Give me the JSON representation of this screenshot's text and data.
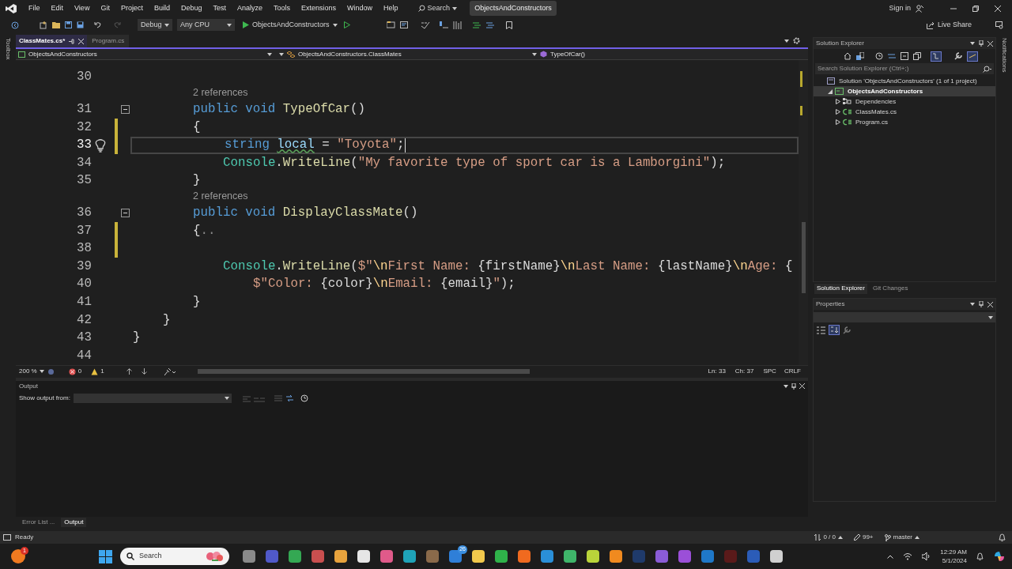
{
  "title_bar": {
    "menu": [
      "File",
      "Edit",
      "View",
      "Git",
      "Project",
      "Build",
      "Debug",
      "Test",
      "Analyze",
      "Tools",
      "Extensions",
      "Window",
      "Help"
    ],
    "search": "Search",
    "solution": "ObjectsAndConstructors",
    "sign_in": "Sign in"
  },
  "toolbar": {
    "configuration": "Debug",
    "platform": "Any CPU",
    "run_target": "ObjectsAndConstructors",
    "live_share": "Live Share"
  },
  "side_strips": {
    "left": "Toolbox",
    "right": "Notifications"
  },
  "editor": {
    "tabs": [
      {
        "label": "ClassMates.cs*",
        "selected": true
      },
      {
        "label": "Program.cs",
        "selected": false
      }
    ],
    "navigation": [
      "ObjectsAndConstructors",
      "ObjectsAndConstructors.ClassMates",
      "TypeOfCar()"
    ],
    "lines": [
      {
        "number": "30",
        "current": false,
        "changed": false,
        "lightbulb": false,
        "collapsible": false
      },
      {
        "number": "31",
        "current": false,
        "changed": false,
        "lightbulb": false,
        "collapsible": true,
        "codelens": "2 references",
        "tokens": [
          {
            "kind": "keyword",
            "text": "        public void "
          },
          {
            "kind": "method",
            "text": "TypeOfCar"
          },
          {
            "kind": "plain",
            "text": "()"
          }
        ]
      },
      {
        "number": "32",
        "current": false,
        "changed": true,
        "lightbulb": false,
        "collapsible": false,
        "tokens": [
          {
            "kind": "plain",
            "text": "        {"
          }
        ]
      },
      {
        "number": "33",
        "current": true,
        "changed": true,
        "lightbulb": true,
        "collapsible": false,
        "tokens": [
          {
            "kind": "keyword",
            "text": "            string "
          },
          {
            "kind": "warning",
            "text": "local"
          },
          {
            "kind": "plain",
            "text": " = "
          },
          {
            "kind": "string",
            "text": "\"Toyota\""
          },
          {
            "kind": "plain",
            "text": ";"
          }
        ]
      },
      {
        "number": "34",
        "current": false,
        "changed": false,
        "lightbulb": false,
        "collapsible": false,
        "tokens": [
          {
            "kind": "type",
            "text": "            Console"
          },
          {
            "kind": "plain",
            "text": "."
          },
          {
            "kind": "method",
            "text": "WriteLine"
          },
          {
            "kind": "plain",
            "text": "("
          },
          {
            "kind": "string",
            "text": "\"My favorite type of sport car is a Lamborgini\""
          },
          {
            "kind": "plain",
            "text": ");"
          }
        ]
      },
      {
        "number": "35",
        "current": false,
        "changed": false,
        "lightbulb": false,
        "collapsible": false,
        "tokens": [
          {
            "kind": "plain",
            "text": "        }"
          }
        ]
      },
      {
        "number": "36",
        "current": false,
        "changed": false,
        "lightbulb": false,
        "collapsible": true,
        "codelens": "2 references",
        "tokens": [
          {
            "kind": "keyword",
            "text": "        public void "
          },
          {
            "kind": "method",
            "text": "DisplayClassMate"
          },
          {
            "kind": "plain",
            "text": "()"
          }
        ]
      },
      {
        "number": "37",
        "current": false,
        "changed": true,
        "lightbulb": false,
        "collapsible": false,
        "tokens": [
          {
            "kind": "plain",
            "text": "        {"
          },
          {
            "kind": "collapsed",
            "text": ".."
          }
        ]
      },
      {
        "number": "38",
        "current": false,
        "changed": true,
        "lightbulb": false,
        "collapsible": false
      },
      {
        "number": "39",
        "current": false,
        "changed": false,
        "lightbulb": false,
        "collapsible": false,
        "tokens": [
          {
            "kind": "type",
            "text": "            Console"
          },
          {
            "kind": "plain",
            "text": "."
          },
          {
            "kind": "method",
            "text": "WriteLine"
          },
          {
            "kind": "plain",
            "text": "("
          },
          {
            "kind": "string",
            "text": "$\""
          },
          {
            "kind": "escape",
            "text": "\\n"
          },
          {
            "kind": "string",
            "text": "First Name: "
          },
          {
            "kind": "plain",
            "text": "{firstName}"
          },
          {
            "kind": "escape",
            "text": "\\n"
          },
          {
            "kind": "string",
            "text": "Last Name: "
          },
          {
            "kind": "plain",
            "text": "{lastName}"
          },
          {
            "kind": "escape",
            "text": "\\n"
          },
          {
            "kind": "string",
            "text": "Age: "
          },
          {
            "kind": "plain",
            "text": "{"
          }
        ]
      },
      {
        "number": "40",
        "current": false,
        "changed": false,
        "lightbulb": false,
        "collapsible": false,
        "tokens": [
          {
            "kind": "string",
            "text": "                $\"Color: "
          },
          {
            "kind": "plain",
            "text": "{color}"
          },
          {
            "kind": "escape",
            "text": "\\n"
          },
          {
            "kind": "string",
            "text": "Email: "
          },
          {
            "kind": "plain",
            "text": "{email}"
          },
          {
            "kind": "string",
            "text": "\""
          },
          {
            "kind": "plain",
            "text": ");"
          }
        ]
      },
      {
        "number": "41",
        "current": false,
        "changed": false,
        "lightbulb": false,
        "collapsible": false,
        "tokens": [
          {
            "kind": "plain",
            "text": "        }"
          }
        ]
      },
      {
        "number": "42",
        "current": false,
        "changed": false,
        "lightbulb": false,
        "collapsible": false,
        "tokens": [
          {
            "kind": "plain",
            "text": "    }"
          }
        ]
      },
      {
        "number": "43",
        "current": false,
        "changed": false,
        "lightbulb": false,
        "collapsible": false,
        "tokens": [
          {
            "kind": "plain",
            "text": "}"
          }
        ]
      },
      {
        "number": "44",
        "current": false,
        "changed": false,
        "lightbulb": false,
        "collapsible": false
      }
    ],
    "status": {
      "zoom": "200 %",
      "errors": "0",
      "warnings": "1",
      "line": "Ln: 33",
      "column": "Ch: 37",
      "whitespace": "SPC",
      "line_ending": "CRLF"
    }
  },
  "output": {
    "title": "Output",
    "show_from_label": "Show output from:"
  },
  "bottom_tabs": [
    {
      "label": "Error List ...",
      "selected": false
    },
    {
      "label": "Output",
      "selected": true
    }
  ],
  "solution_explorer": {
    "title": "Solution Explorer",
    "search_placeholder": "Search Solution Explorer (Ctrl+;)",
    "tree": [
      {
        "label": "Solution 'ObjectsAndConstructors' (1 of 1 project)",
        "kind": "solution",
        "selected": false,
        "children": [
          {
            "label": "ObjectsAndConstructors",
            "kind": "project",
            "expanded": true,
            "selected": true,
            "children": [
              {
                "label": "Dependencies",
                "kind": "dependencies",
                "expanded": false,
                "selected": false
              },
              {
                "label": "ClassMates.cs",
                "kind": "csharp",
                "expanded": false,
                "selected": false
              },
              {
                "label": "Program.cs",
                "kind": "csharp",
                "expanded": false,
                "selected": false
              }
            ]
          }
        ]
      }
    ]
  },
  "panel_tabs": [
    {
      "label": "Solution Explorer",
      "selected": true
    },
    {
      "label": "Git Changes",
      "selected": false
    }
  ],
  "properties": {
    "title": "Properties"
  },
  "status_bar": {
    "state": "Ready",
    "changes": "0 / 0",
    "edits": "99+",
    "branch": "master"
  },
  "taskbar": {
    "widget_badge": "1",
    "search": "Search",
    "apps": [
      {
        "color": "#8a8a8a"
      },
      {
        "color": "#5059c9"
      },
      {
        "color": "#34a853"
      },
      {
        "color": "#c94f4f"
      },
      {
        "color": "#e8a33d"
      },
      {
        "color": "#e6e6e6"
      },
      {
        "color": "#e05a8a"
      },
      {
        "color": "#1fa3b8"
      },
      {
        "color": "#8a6a4a"
      },
      {
        "color": "#2f7fd8",
        "badge": "26"
      },
      {
        "color": "#f2c94c"
      },
      {
        "color": "#2fb34a"
      },
      {
        "color": "#f06a1f"
      },
      {
        "color": "#2a8fd8"
      },
      {
        "color": "#3fb56a"
      },
      {
        "color": "#b9d43a"
      },
      {
        "color": "#f08a1f"
      },
      {
        "color": "#1f3a6a"
      },
      {
        "color": "#8a5cd6"
      },
      {
        "color": "#9b4fd8"
      },
      {
        "color": "#1f78c8"
      },
      {
        "color": "#5a1a1a"
      },
      {
        "color": "#2b5cb8"
      },
      {
        "color": "#d0d0d0"
      }
    ],
    "time": "12:29 AM",
    "date": "5/1/2024"
  }
}
